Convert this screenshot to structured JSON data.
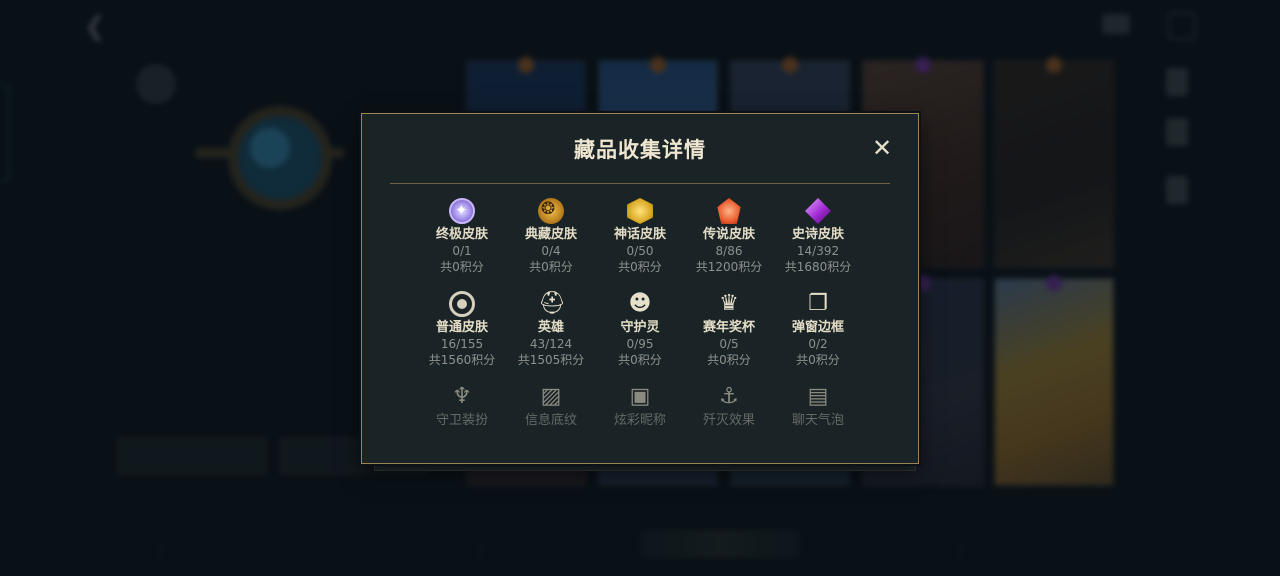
{
  "modal": {
    "title": "藏品收集详情",
    "close_label": "✕",
    "items": [
      {
        "name": "终极皮肤",
        "count": "0/1",
        "points": "共0积分",
        "icon": "ultimate-skin-icon"
      },
      {
        "name": "典藏皮肤",
        "count": "0/4",
        "points": "共0积分",
        "icon": "legacy-skin-icon"
      },
      {
        "name": "神话皮肤",
        "count": "0/50",
        "points": "共0积分",
        "icon": "mythic-skin-icon"
      },
      {
        "name": "传说皮肤",
        "count": "8/86",
        "points": "共1200积分",
        "icon": "legendary-skin-icon"
      },
      {
        "name": "史诗皮肤",
        "count": "14/392",
        "points": "共1680积分",
        "icon": "epic-skin-icon"
      },
      {
        "name": "普通皮肤",
        "count": "16/155",
        "points": "共1560积分",
        "icon": "standard-skin-icon"
      },
      {
        "name": "英雄",
        "count": "43/124",
        "points": "共1505积分",
        "icon": "helmet-icon"
      },
      {
        "name": "守护灵",
        "count": "0/95",
        "points": "共0积分",
        "icon": "guardian-icon"
      },
      {
        "name": "赛年奖杯",
        "count": "0/5",
        "points": "共0积分",
        "icon": "trophy-icon"
      },
      {
        "name": "弹窗边框",
        "count": "0/2",
        "points": "共0积分",
        "icon": "frame-icon"
      },
      {
        "name": "守卫装扮",
        "icon": "ward-icon"
      },
      {
        "name": "信息底纹",
        "icon": "picture-icon"
      },
      {
        "name": "炫彩昵称",
        "icon": "crown-card-icon"
      },
      {
        "name": "歼灭效果",
        "icon": "anchor-icon"
      },
      {
        "name": "聊天气泡",
        "icon": "chat-bubble-icon"
      }
    ]
  }
}
